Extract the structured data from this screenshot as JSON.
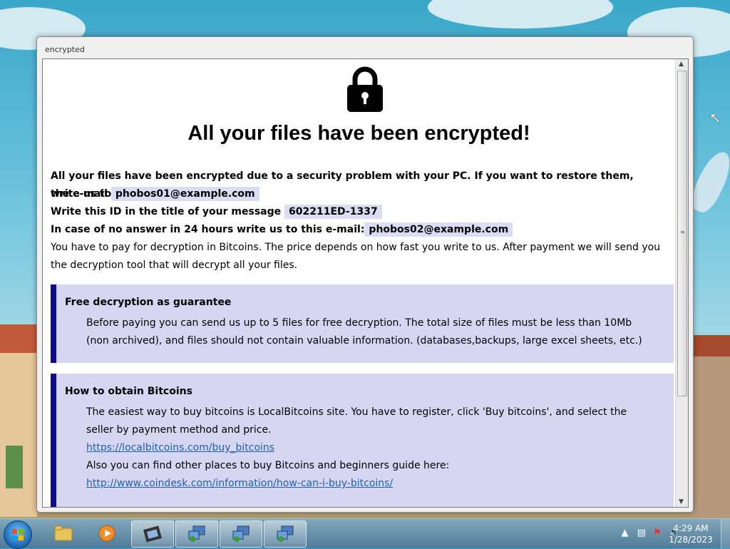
{
  "window": {
    "title": "encrypted"
  },
  "headline": "All your files have been encrypted!",
  "intro": {
    "line1": "All your files have been encrypted due to a security problem with your PC. If you want to restore them, write us to",
    "email_prefix": "the e-mail",
    "email1": "phobos01@example.com",
    "id_prefix": "Write this ID in the title of your message",
    "id_value": "602211ED-1337",
    "noanswer_prefix": "In case of no answer in 24 hours write us to this e-mail:",
    "email2": "phobos02@example.com",
    "payment_text": "You have to pay for decryption in Bitcoins. The price depends on how fast you write to us. After payment we will send you the decryption tool that will decrypt all your files."
  },
  "guarantee": {
    "title": "Free decryption as guarantee",
    "body": "Before paying you can send us up to 5 files for free decryption. The total size of files must be less than 10Mb (non archived), and files should not contain valuable information. (databases,backups, large excel sheets, etc.)"
  },
  "bitcoins": {
    "title": "How to obtain Bitcoins",
    "body1": "The easiest way to buy bitcoins is LocalBitcoins site. You have to register, click 'Buy bitcoins', and select the seller by payment method and price.",
    "link1": "https://localbitcoins.com/buy_bitcoins",
    "body2": "Also you can find other places to buy Bitcoins and beginners guide here:",
    "link2": "http://www.coindesk.com/information/how-can-i-buy-bitcoins/"
  },
  "taskbar": {
    "clock_time": "4:29 AM",
    "clock_date": "1/28/2023"
  },
  "colors": {
    "box_bg": "#d6d6f2",
    "box_accent": "#0c0c8c",
    "highlight_bg": "#dcdcf4",
    "link": "#2062a8"
  }
}
